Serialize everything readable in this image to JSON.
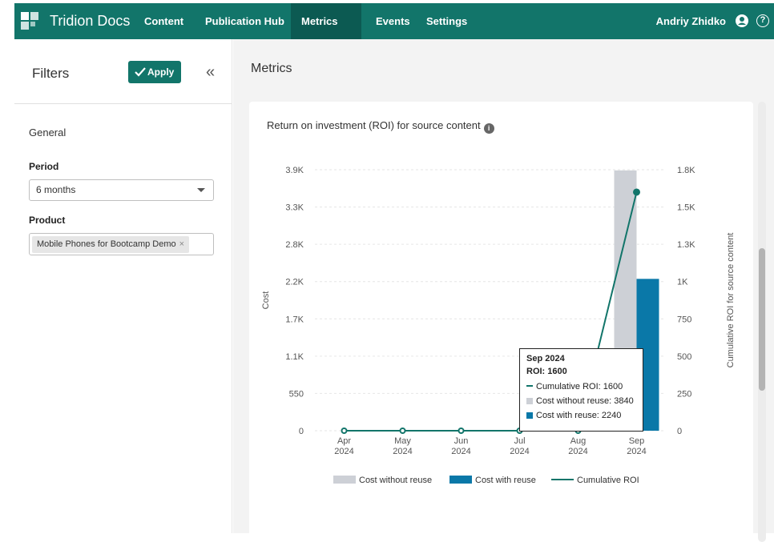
{
  "app": {
    "brand": "Tridion Docs",
    "nav": [
      "Content",
      "Publication Hub",
      "Metrics",
      "Events",
      "Settings"
    ],
    "active_nav": "Metrics",
    "user_name": "Andriy Zhidko",
    "help_symbol": "?"
  },
  "sidebar": {
    "title": "Filters",
    "apply_label": "Apply",
    "collapse_symbol": "«",
    "section": "General",
    "period_label": "Period",
    "period_value": "6 months",
    "product_label": "Product",
    "product_chip": "Mobile Phones for Bootcamp Demo",
    "chip_remove_symbol": "×"
  },
  "main": {
    "title": "Metrics"
  },
  "card": {
    "title": "Return on investment (ROI) for source content",
    "info_symbol": "i"
  },
  "tooltip": {
    "date": "Sep 2024",
    "roi": "ROI: 1600",
    "rows": [
      "Cumulative ROI: 1600",
      "Cost without reuse: 3840",
      "Cost with reuse: 2240"
    ]
  },
  "chart_data": {
    "type": "bar",
    "title": "Return on investment (ROI) for source content",
    "categories": [
      "Apr\n2024",
      "May\n2024",
      "Jun\n2024",
      "Jul\n2024",
      "Aug\n2024",
      "Sep\n2024"
    ],
    "series": [
      {
        "name": "Cost without reuse",
        "type": "bar",
        "axis": "left",
        "color": "#cdd0d6",
        "values": [
          0,
          0,
          0,
          0,
          0,
          3840
        ]
      },
      {
        "name": "Cost with reuse",
        "type": "bar",
        "axis": "left",
        "color": "#0a78a8",
        "values": [
          0,
          0,
          0,
          0,
          0,
          2240
        ]
      },
      {
        "name": "Cumulative ROI",
        "type": "line",
        "axis": "right",
        "color": "#12756a",
        "values": [
          0,
          0,
          0,
          0,
          0,
          1600
        ]
      }
    ],
    "ylabel": "Cost",
    "y2label": "Cumulative ROI for source content",
    "y_ticks": [
      "0",
      "550",
      "1.1K",
      "1.7K",
      "2.2K",
      "2.8K",
      "3.3K",
      "3.9K"
    ],
    "y_tick_values": [
      0,
      550,
      1100,
      1650,
      2200,
      2750,
      3300,
      3850
    ],
    "y2_ticks": [
      "0",
      "250",
      "500",
      "750",
      "1K",
      "1.3K",
      "1.5K",
      "1.8K"
    ],
    "y2_tick_values": [
      0,
      250,
      500,
      750,
      1000,
      1250,
      1500,
      1750
    ],
    "ylim": [
      0,
      3850
    ],
    "y2lim": [
      0,
      1750
    ],
    "grid": true,
    "legend": "bottom"
  },
  "colors": {
    "brand": "#12756a",
    "nav_active": "#0c5a52",
    "bar_without_reuse": "#cdd0d6",
    "bar_with_reuse": "#0a78a8"
  }
}
